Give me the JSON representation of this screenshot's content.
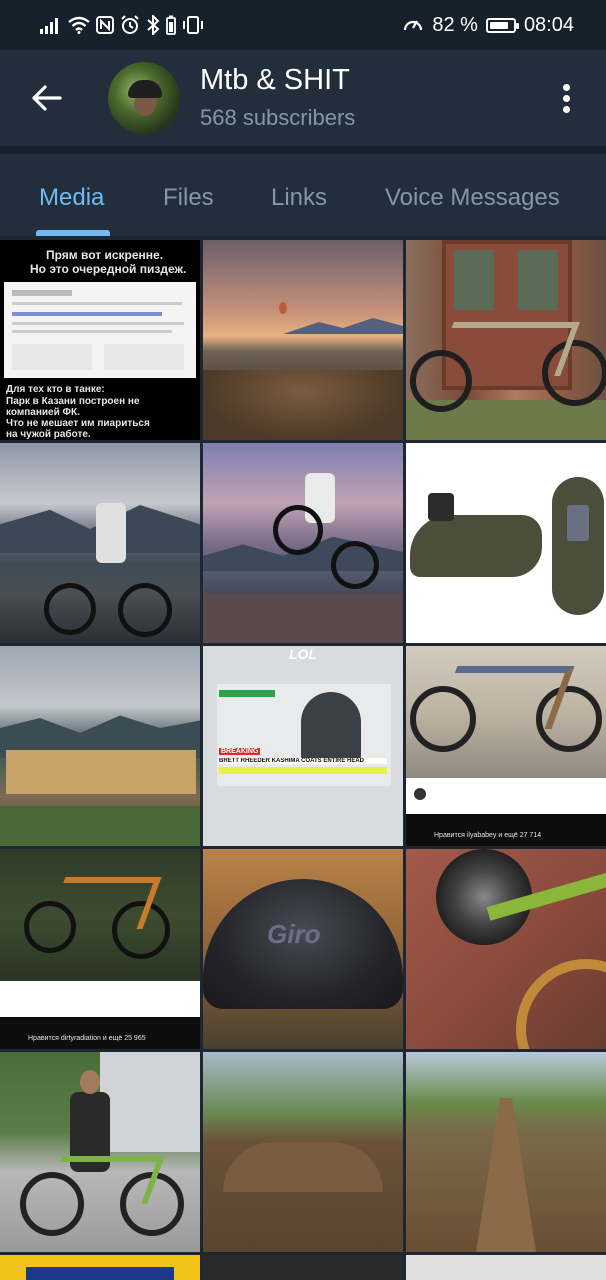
{
  "status_bar": {
    "battery_percent": "82 %",
    "time": "08:04",
    "battery_level": 0.82,
    "icons": [
      "signal-icon",
      "wifi-icon",
      "nfc-icon",
      "alarm-icon",
      "bluetooth-icon",
      "vibrate-icon",
      "speed-icon",
      "battery-icon"
    ]
  },
  "header": {
    "title": "Mtb & SHIT",
    "subtitle": "568 subscribers",
    "back_icon": "back-arrow-icon",
    "menu_icon": "more-vertical-icon"
  },
  "tabs": [
    {
      "label": "Media",
      "active": true
    },
    {
      "label": "Files",
      "active": false
    },
    {
      "label": "Links",
      "active": false
    },
    {
      "label": "Voice Messages",
      "active": false
    }
  ],
  "media_grid": {
    "columns": 3,
    "items": [
      {
        "description": "screenshot-meme",
        "caption_top": "Прям вот искренне.",
        "caption_top2": "Но это очередной пиздеж.",
        "caption_bottom": "Для тех кто в танке:",
        "caption_bottom2": "Парк в Казани построен не",
        "caption_bottom3": "компанией ФК.",
        "caption_bottom4": "Что не мешает им пиариться",
        "caption_bottom5": "на чужой работе."
      },
      {
        "description": "pump-track-sunset"
      },
      {
        "description": "bike-against-door"
      },
      {
        "description": "rider-on-bike-mountains"
      },
      {
        "description": "rider-jumping-mountains"
      },
      {
        "description": "crocs-with-light"
      },
      {
        "description": "mountain-resort-town"
      },
      {
        "description": "news-breaking-screenshot",
        "lol": "LOL",
        "breaking": "BREAKING",
        "headline": "BRETT RHEEDER KASHIMA COATS ENTIRE HEAD"
      },
      {
        "description": "instagram-bike-post",
        "likes": "Нравится ilyababey и ещё 27 714"
      },
      {
        "description": "instagram-orange-bike",
        "likes": "Нравится dirtyradiation и ещё 25 965"
      },
      {
        "description": "helmet-closeup",
        "brand": "Giro"
      },
      {
        "description": "cassette-closeup"
      },
      {
        "description": "man-with-green-ebike"
      },
      {
        "description": "dirt-jumps-track"
      },
      {
        "description": "dirt-jumps-track-wide"
      },
      {
        "description": "partial-tile-1"
      },
      {
        "description": "partial-tile-2"
      },
      {
        "description": "partial-tile-3"
      }
    ]
  }
}
